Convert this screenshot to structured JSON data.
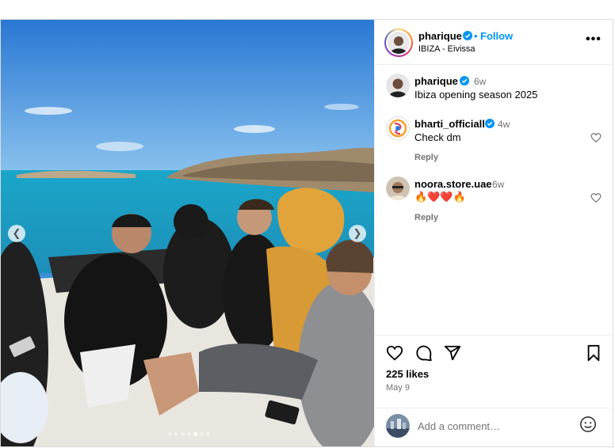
{
  "post": {
    "author": {
      "username": "pharique",
      "verified": true,
      "follow_separator": "•",
      "follow_label": "Follow",
      "location": "IBIZA - Eivissa",
      "more_label": "•••"
    },
    "media": {
      "carousel_total": 7,
      "carousel_active_index": 4,
      "prev_icon": "chevron-left",
      "next_icon": "chevron-right"
    },
    "comments": [
      {
        "username": "pharique",
        "verified": true,
        "time": "6w",
        "text": "Ibiza opening season 2025",
        "has_reply": false
      },
      {
        "username": "bharti_officiall",
        "verified": true,
        "time": "4w",
        "text": "Check dm",
        "reply_label": "Reply",
        "has_reply": true
      },
      {
        "username": "noora.store.uae",
        "verified": false,
        "time": "6w",
        "text": "🔥❤️❤️🔥",
        "reply_label": "Reply",
        "has_reply": true
      }
    ],
    "actions": {
      "like_icon": "heart",
      "comment_icon": "speech-bubble",
      "share_icon": "paper-plane",
      "save_icon": "bookmark"
    },
    "likes": "225 likes",
    "date": "May 9",
    "comment_box": {
      "placeholder": "Add a comment…",
      "emoji_icon": "smiley"
    }
  },
  "colors": {
    "link_blue": "#0095f6",
    "muted_text": "#737373",
    "border": "#dbdbdb",
    "verified_blue": "#0095f6"
  }
}
